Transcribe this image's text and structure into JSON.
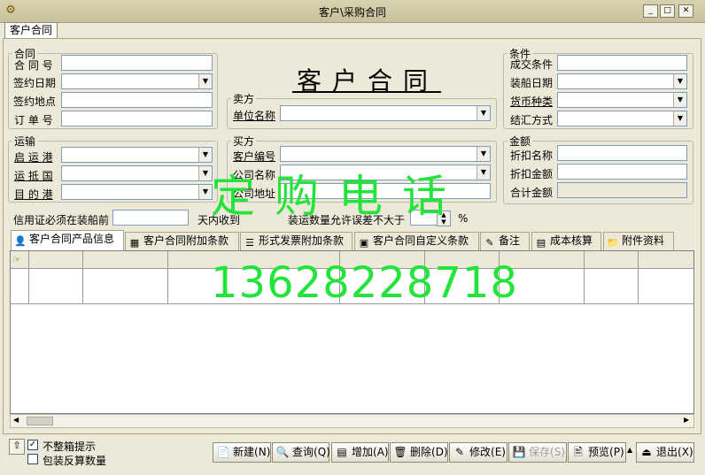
{
  "window": {
    "title": "客户\\采购合同",
    "tab": "客户合同"
  },
  "heading": "客户合同",
  "contract": {
    "legend": "合同",
    "no_label": "合 同 号",
    "date_label": "签约日期",
    "place_label": "签约地点",
    "order_label": "订 单 号"
  },
  "seller": {
    "legend": "卖方",
    "unit_label": "单位名称"
  },
  "transport": {
    "legend": "运输",
    "origin_label": "启 运 港",
    "via_label": "运 抵 国",
    "dest_label": "目 的 港"
  },
  "buyer": {
    "legend": "买方",
    "code_label": "客户编号",
    "company_label": "公司名称",
    "address_label": "公司地址"
  },
  "terms": {
    "legend": "条件",
    "deal_label": "成交条件",
    "ship_date_label": "装船日期",
    "currency_label": "货币种类",
    "settle_label": "结汇方式"
  },
  "amount": {
    "legend": "金额",
    "discount_name_label": "折扣名称",
    "discount_amount_label": "折扣金额",
    "total_label": "合计金额"
  },
  "lc": {
    "prefix": "信用证必须在装船前",
    "suffix": "天内收到"
  },
  "tolerance": {
    "label": "装运数量允许误差不大于",
    "unit": "%"
  },
  "watermark": {
    "line1": "定购电话",
    "line2": "13628228718"
  },
  "detail_tabs": [
    {
      "label": "客户合同产品信息",
      "icon": "person-folder-icon"
    },
    {
      "label": "客户合同附加条款",
      "icon": "add-doc-icon"
    },
    {
      "label": "形式发票附加条款",
      "icon": "invoice-icon"
    },
    {
      "label": "客户合同自定义条款",
      "icon": "custom-icon"
    },
    {
      "label": "备注",
      "icon": "note-icon"
    },
    {
      "label": "成本核算",
      "icon": "calculator-icon"
    },
    {
      "label": "附件资料",
      "icon": "attachment-icon"
    }
  ],
  "options": {
    "no_whole_box": "不整箱提示",
    "no_whole_box_checked": true,
    "pack_reverse": "包装反算数量",
    "pack_reverse_checked": false
  },
  "buttons": {
    "new": "新建",
    "new_key": "N",
    "query": "查询",
    "query_key": "Q",
    "add": "增加",
    "add_key": "A",
    "delete": "删除",
    "delete_key": "D",
    "edit": "修改",
    "edit_key": "E",
    "save": "保存",
    "save_key": "S",
    "preview": "预览",
    "preview_key": "P",
    "exit": "退出",
    "exit_key": "X"
  }
}
